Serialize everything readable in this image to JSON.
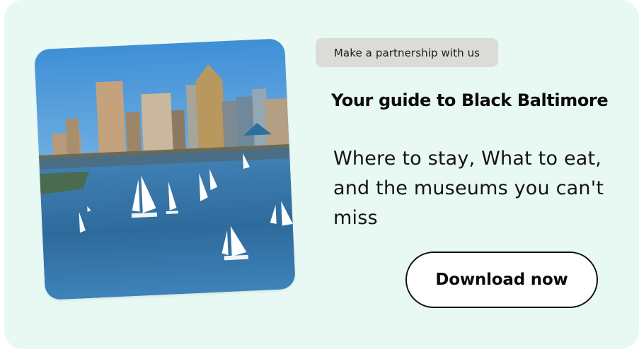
{
  "card": {
    "background": "#e8f8f3"
  },
  "image": {
    "alt": "Baltimore Inner Harbor skyline with sailboats"
  },
  "partnership_badge": {
    "label": "Make a partnership with us"
  },
  "headline": {
    "text": "Your guide to Black Baltimore"
  },
  "description": {
    "text": "Where to stay, What to eat, and the museums you can't miss"
  },
  "cta": {
    "label": "Download now"
  }
}
